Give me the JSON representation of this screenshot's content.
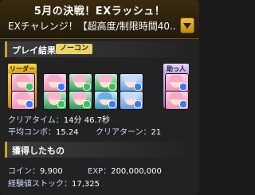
{
  "header": {
    "title": "5月の決戦！EXラッシュ！",
    "subtitle": "EXチャレンジ！【超高度/制限時間40..."
  },
  "result_section": {
    "label": "プレイ結果",
    "badge": "ノーコン",
    "leader_tag": "リーダー",
    "helper_tag": "助っ人"
  },
  "stats": {
    "clear_time_label": "クリアタイム：",
    "clear_time_value": "14分 46.7秒",
    "avg_combo_label": "平均コンボ：",
    "avg_combo_value": "15.24",
    "clear_turn_label": "クリアターン：",
    "clear_turn_value": "21"
  },
  "rewards_section": {
    "label": "獲得したもの",
    "coin_label": "コイン：",
    "coin_value": "9,900",
    "exp_label": "EXP：",
    "exp_value": "200,000,000",
    "exp_stock_label": "経験値ストック：",
    "exp_stock_value": "17,325"
  },
  "party": [
    {
      "id": "leader",
      "color": "pink",
      "elem": "#3cc25b"
    },
    {
      "id": "m1",
      "color": "pink",
      "elem": "#3a79ff"
    },
    {
      "id": "m2",
      "color": "green",
      "elem": "#3cc25b"
    },
    {
      "id": "m3",
      "color": "green",
      "elem": "#3cc25b"
    },
    {
      "id": "m4",
      "color": "blue",
      "elem": "#3a79ff"
    },
    {
      "id": "helper",
      "color": "pink",
      "elem": "#3a79ff"
    }
  ],
  "subs": [
    {
      "color": "pink",
      "elem": "#3a79ff"
    },
    {
      "color": "green",
      "elem": "#3cc25b"
    },
    {
      "color": "green",
      "elem": "#3cc25b"
    },
    {
      "color": "cyan",
      "elem": "#3a79ff"
    },
    {
      "color": "blue",
      "elem": "#3a79ff"
    },
    {
      "color": "pink",
      "elem": "#3a79ff"
    }
  ]
}
